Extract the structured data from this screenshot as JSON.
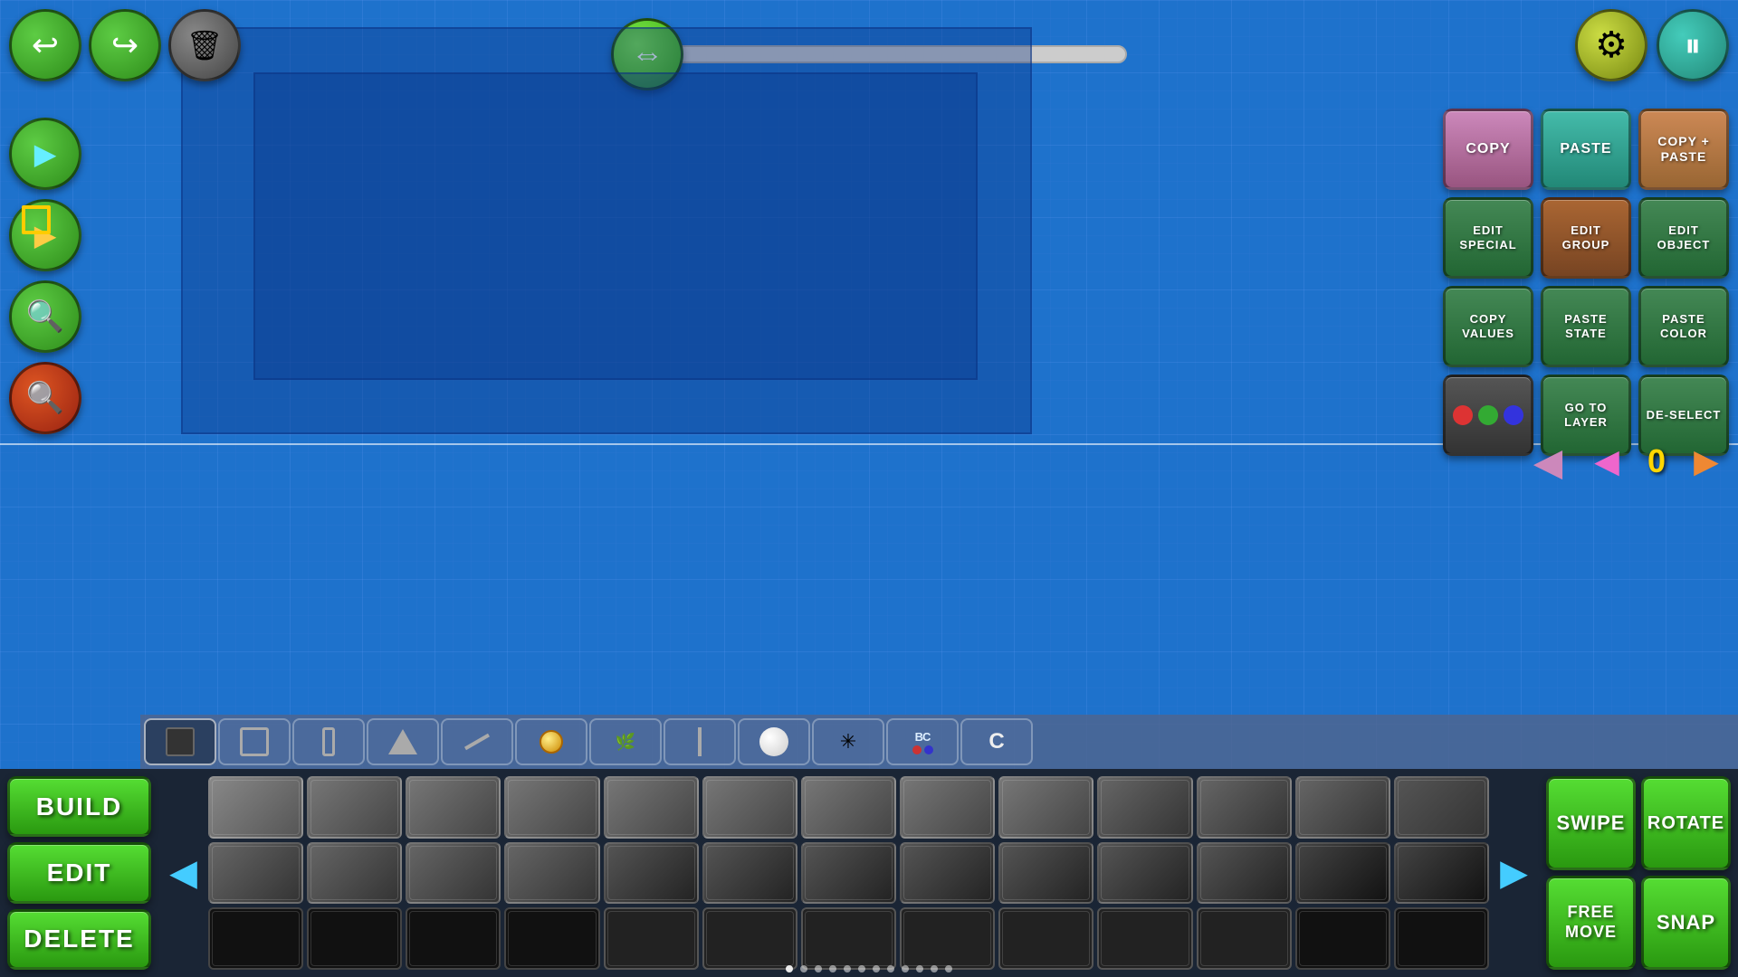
{
  "canvas": {
    "bg_color": "#1e72cc"
  },
  "top_toolbar": {
    "undo_label": "↩",
    "redo_label": "↪",
    "delete_label": "🗑"
  },
  "speed_control": {
    "value": 0
  },
  "top_right": {
    "gear_label": "⚙",
    "pause_label": "⏸"
  },
  "left_toolbar": {
    "music_label": "▶",
    "stop_label": "▣",
    "zoom_in_label": "+🔍",
    "zoom_out_label": "-🔍"
  },
  "right_panel": {
    "copy_label": "COPY",
    "paste_label": "PASTE",
    "copy_paste_label": "COPY + PASTE",
    "edit_special_label": "EDIT SPECIAL",
    "edit_group_label": "EDIT GROUP",
    "edit_object_label": "EDIT OBJECT",
    "copy_values_label": "COPY VALUES",
    "paste_state_label": "PASTE STATE",
    "paste_color_label": "PASTE COLOR",
    "color_picker_label": "",
    "go_to_layer_label": "GO TO LAYER",
    "deselect_label": "DE-SELECT"
  },
  "layer_nav": {
    "left_label": "◀",
    "left_pink_label": "◀",
    "value": "0",
    "right_label": "▶"
  },
  "obj_tabs": [
    {
      "id": "solid",
      "active": true
    },
    {
      "id": "outline"
    },
    {
      "id": "slope"
    },
    {
      "id": "triangle"
    },
    {
      "id": "ramp"
    },
    {
      "id": "circle"
    },
    {
      "id": "grass"
    },
    {
      "id": "pole"
    },
    {
      "id": "sphere"
    },
    {
      "id": "burst"
    },
    {
      "id": "bc"
    },
    {
      "id": "c"
    }
  ],
  "bottom_nav": {
    "build_label": "BUILD",
    "edit_label": "EDIT",
    "delete_label": "DELETE"
  },
  "action_btns": {
    "swipe_label": "SWIPE",
    "rotate_label": "ROTATE",
    "free_move_label": "FREE MOVE",
    "snap_label": "SNAP"
  },
  "page_dots": [
    0,
    1,
    2,
    3,
    4,
    5,
    6,
    7,
    8,
    9,
    10,
    11
  ]
}
